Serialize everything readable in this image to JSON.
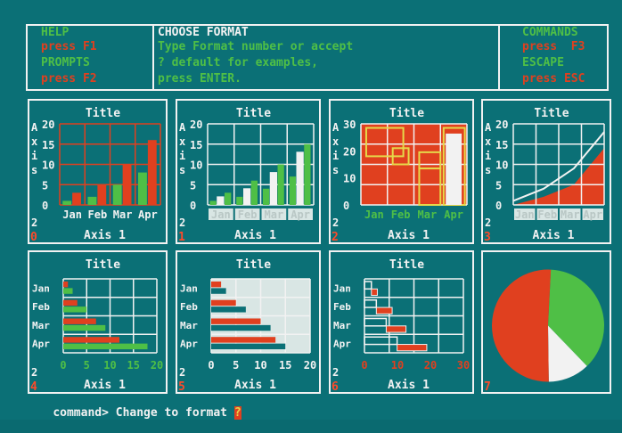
{
  "colors": {
    "background": "#0b7076",
    "green": "#4fbf46",
    "red": "#e0401f",
    "white": "#f2f2f2",
    "yellow": "#e6d84a",
    "pale": "#d9e6e4",
    "num": "#ff4a2a"
  },
  "header": {
    "help_title": "HELP",
    "help_key": "press F1",
    "prompts_title": "PROMPTS",
    "prompts_key": "press F2",
    "choose_title": "CHOOSE FORMAT",
    "choose_line1": "Type Format number or accept",
    "choose_line2": "? default for examples,",
    "choose_line3": "press ENTER.",
    "commands_title": "COMMANDS",
    "commands_key": "press  F3",
    "escape_title": "ESCAPE",
    "escape_key": "press ESC"
  },
  "command_line": {
    "prompt": "command> Change to format ",
    "cursor": "?"
  },
  "panels": [
    {
      "id": "0",
      "title": "Title",
      "ylabel": "Axis 2",
      "xlabel": "Axis 1",
      "yticks": [
        "20",
        "15",
        "10",
        "5",
        "0"
      ],
      "xticks": [
        "Jan",
        "Feb",
        "Mar",
        "Apr"
      ]
    },
    {
      "id": "1",
      "title": "Title",
      "ylabel": "Axis 2",
      "xlabel": "Axis 1",
      "yticks": [
        "20",
        "15",
        "10",
        "5",
        "0"
      ],
      "xticks": [
        "Jan",
        "Feb",
        "Mar",
        "Apr"
      ]
    },
    {
      "id": "2",
      "title": "Title",
      "ylabel": "Axis 2",
      "xlabel": "Axis 1",
      "yticks": [
        "30",
        "20",
        "10",
        "0"
      ],
      "xticks": [
        "Jan",
        "Feb",
        "Mar",
        "Apr"
      ]
    },
    {
      "id": "3",
      "title": "Title",
      "ylabel": "Axis 2",
      "xlabel": "Axis 1",
      "yticks": [
        "20",
        "15",
        "10",
        "5",
        "0"
      ],
      "xticks": [
        "Jan",
        "Feb",
        "Mar",
        "Apr"
      ]
    },
    {
      "id": "4",
      "title": "Title",
      "ylabel": "Axis 2",
      "xlabel": "Axis 1",
      "yticks": [
        "Jan",
        "Feb",
        "Mar",
        "Apr"
      ],
      "xticks": [
        "0",
        "5",
        "10",
        "15",
        "20"
      ]
    },
    {
      "id": "5",
      "title": "Title",
      "ylabel": "Axis 2",
      "xlabel": "Axis 1",
      "yticks": [
        "Jan",
        "Feb",
        "Mar",
        "Apr"
      ],
      "xticks": [
        "0",
        "5",
        "10",
        "15",
        "20"
      ]
    },
    {
      "id": "6",
      "title": "Title",
      "ylabel": "Axis 2",
      "xlabel": "Axis 1",
      "yticks": [
        "Jan",
        "Feb",
        "Mar",
        "Apr"
      ],
      "xticks": [
        "0",
        "10",
        "20",
        "30"
      ]
    },
    {
      "id": "7",
      "title": "",
      "ylabel": "",
      "xlabel": "",
      "yticks": [],
      "xticks": []
    }
  ],
  "chart_data": [
    {
      "type": "bar",
      "format": "0",
      "categories": [
        "Jan",
        "Feb",
        "Mar",
        "Apr"
      ],
      "series": [
        {
          "values": [
            1,
            2,
            5,
            8
          ]
        },
        {
          "values": [
            3,
            5,
            10,
            16
          ]
        }
      ],
      "ylim": [
        0,
        20
      ]
    },
    {
      "type": "bar",
      "format": "1",
      "categories": [
        "Jan",
        "Feb",
        "Mar",
        "Apr"
      ],
      "series": [
        {
          "values": [
            1,
            2,
            4,
            7
          ]
        },
        {
          "values": [
            2,
            4,
            8,
            13
          ]
        },
        {
          "values": [
            3,
            6,
            10,
            15
          ]
        }
      ],
      "ylim": [
        0,
        20
      ]
    },
    {
      "type": "bar",
      "format": "2",
      "categories": [
        "Jan",
        "Feb",
        "Mar",
        "Apr"
      ],
      "ylim": [
        0,
        30
      ]
    },
    {
      "type": "area",
      "format": "3",
      "categories": [
        "Jan",
        "Feb",
        "Mar",
        "Apr"
      ],
      "series": [
        {
          "values": [
            0,
            2,
            5,
            14
          ]
        },
        {
          "values": [
            1,
            4,
            9,
            18
          ]
        }
      ],
      "ylim": [
        0,
        20
      ]
    },
    {
      "type": "bar",
      "format": "4",
      "orientation": "horizontal",
      "categories": [
        "Jan",
        "Feb",
        "Mar",
        "Apr"
      ],
      "series": [
        {
          "values": [
            1,
            3,
            7,
            12
          ]
        },
        {
          "values": [
            2,
            5,
            9,
            18
          ]
        }
      ],
      "xlim": [
        0,
        20
      ]
    },
    {
      "type": "bar",
      "format": "5",
      "orientation": "horizontal",
      "categories": [
        "Jan",
        "Feb",
        "Mar",
        "Apr"
      ],
      "series": [
        {
          "values": [
            2,
            5,
            10,
            13
          ]
        },
        {
          "values": [
            3,
            7,
            12,
            15
          ]
        }
      ],
      "xlim": [
        0,
        20
      ]
    },
    {
      "type": "bar",
      "format": "6",
      "orientation": "horizontal",
      "categories": [
        "Jan",
        "Feb",
        "Mar",
        "Apr"
      ],
      "xlim": [
        0,
        30
      ]
    },
    {
      "type": "pie",
      "format": "7",
      "slices": [
        {
          "value": 37,
          "color": "green"
        },
        {
          "value": 12,
          "color": "white"
        },
        {
          "value": 51,
          "color": "red"
        }
      ]
    }
  ]
}
